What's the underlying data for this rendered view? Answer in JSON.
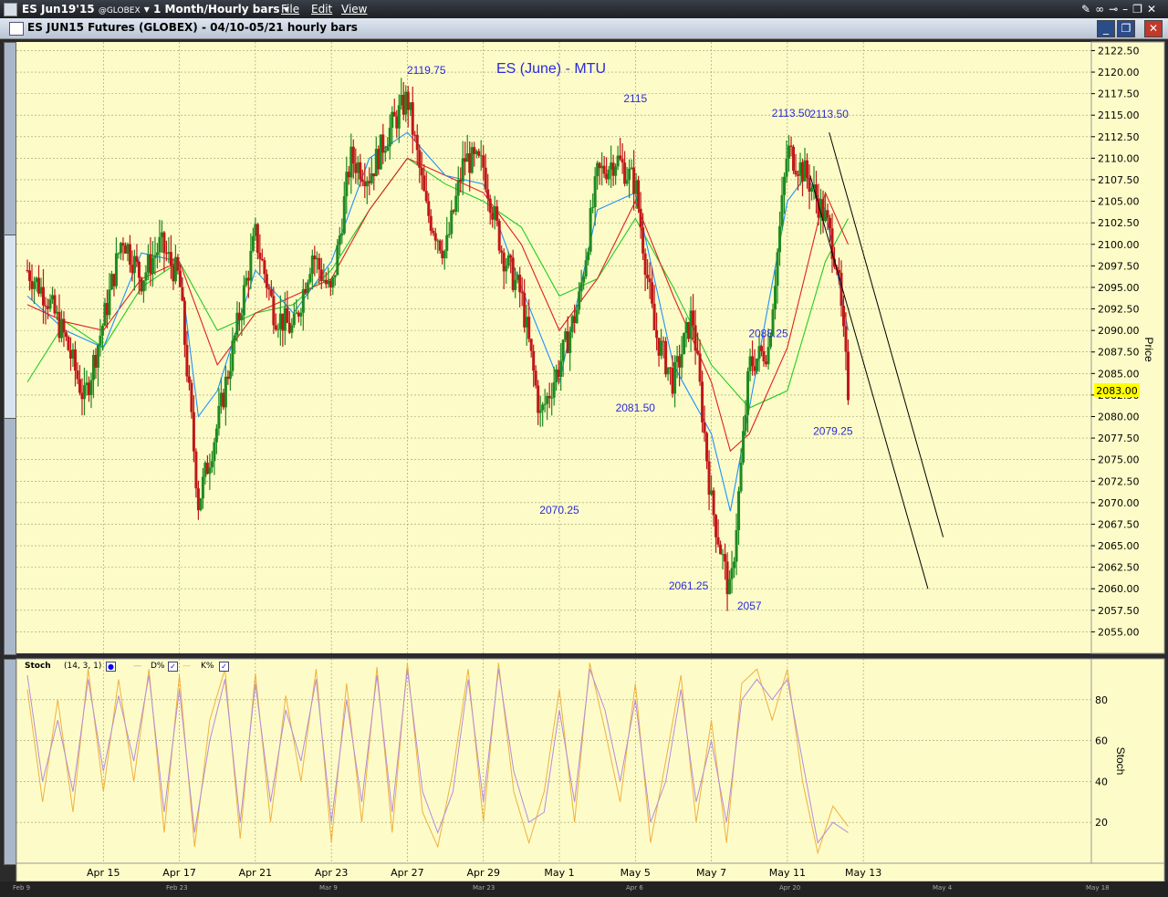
{
  "toolbar": {
    "symbol": "ES Jun19'15",
    "exchange": "@GLOBEX",
    "period": "1 Month/Hourly bars",
    "menu_file": "File",
    "menu_edit": "Edit",
    "menu_view": "View"
  },
  "window": {
    "title": "ES JUN15 Futures (GLOBEX) - 04/10-05/21 hourly bars"
  },
  "colors": {
    "background": "#fdfcc8",
    "up_bar": "#1f8a1f",
    "down_bar": "#c01818",
    "ma_fast": "#1e90ff",
    "ma_mid": "#e02020",
    "ma_slow": "#22cc22",
    "stoch_d": "#b58ce0",
    "stoch_k": "#f0b040",
    "annotation": "#2a2adc",
    "last_price_bg": "#ffff00"
  },
  "chart_data": [
    {
      "type": "line",
      "title": "ES (June) - MTU",
      "ylabel": "Price",
      "ylim": [
        2052.5,
        2123.5
      ],
      "yticks": [
        2122.5,
        2120.0,
        2117.5,
        2115.0,
        2112.5,
        2110.0,
        2107.5,
        2105.0,
        2102.5,
        2100.0,
        2097.5,
        2095.0,
        2092.5,
        2090.0,
        2087.5,
        2085.0,
        2082.5,
        2080.0,
        2077.5,
        2075.0,
        2072.5,
        2070.0,
        2067.5,
        2065.0,
        2062.5,
        2060.0,
        2057.5,
        2055.0
      ],
      "ytick_labels": [
        "2122.50",
        "2120.00",
        "2117.50",
        "2115.00",
        "2112.50",
        "2110.00",
        "2107.50",
        "2105.00",
        "2102.50",
        "2100.00",
        "2097.50",
        "2095.00",
        "2092.50",
        "2090.00",
        "2087.50",
        "2085.00",
        "2082.50",
        "2080.00",
        "2077.50",
        "2075.00",
        "2072.50",
        "2070.00",
        "2067.50",
        "2065.00",
        "2062.50",
        "2060.00",
        "2057.50",
        "2055.00"
      ],
      "last_price": "2083.00",
      "xticks": [
        "Apr 15",
        "Apr 17",
        "Apr 21",
        "Apr 23",
        "Apr 27",
        "Apr 29",
        "May 1",
        "May 5",
        "May 7",
        "May 11",
        "May 13"
      ],
      "x_range": [
        0,
        28
      ],
      "xtick_index": [
        2,
        4,
        6,
        8,
        10,
        12,
        14,
        16,
        18,
        20,
        22
      ],
      "grid": true,
      "price_path": [
        [
          0,
          2097
        ],
        [
          0.5,
          2094
        ],
        [
          1,
          2089
        ],
        [
          1.5,
          2082
        ],
        [
          2,
          2091
        ],
        [
          2.5,
          2101
        ],
        [
          3,
          2096
        ],
        [
          3.5,
          2100
        ],
        [
          4,
          2096
        ],
        [
          4.5,
          2070
        ],
        [
          5,
          2079
        ],
        [
          5.5,
          2090
        ],
        [
          6,
          2101
        ],
        [
          6.5,
          2092
        ],
        [
          7,
          2090
        ],
        [
          7.5,
          2099
        ],
        [
          8,
          2094
        ],
        [
          8.5,
          2110
        ],
        [
          9,
          2108
        ],
        [
          9.5,
          2113
        ],
        [
          10,
          2117
        ],
        [
          10.5,
          2104
        ],
        [
          11,
          2099
        ],
        [
          11.5,
          2110
        ],
        [
          12,
          2109
        ],
        [
          12.5,
          2099
        ],
        [
          13,
          2094
        ],
        [
          13.5,
          2080
        ],
        [
          14,
          2086
        ],
        [
          14.5,
          2093
        ],
        [
          15,
          2108
        ],
        [
          15.5,
          2110
        ],
        [
          16,
          2107
        ],
        [
          16.5,
          2090
        ],
        [
          17,
          2084
        ],
        [
          17.5,
          2092
        ],
        [
          18,
          2070
        ],
        [
          18.5,
          2059
        ],
        [
          19,
          2086
        ],
        [
          19.5,
          2088
        ],
        [
          20,
          2111
        ],
        [
          20.5,
          2108
        ],
        [
          21,
          2103
        ],
        [
          21.3,
          2098
        ],
        [
          21.6,
          2083
        ]
      ],
      "ma_fast": [
        [
          0,
          2094
        ],
        [
          1,
          2090
        ],
        [
          2,
          2088
        ],
        [
          3,
          2099
        ],
        [
          4,
          2098
        ],
        [
          4.5,
          2080
        ],
        [
          5,
          2083
        ],
        [
          6,
          2097
        ],
        [
          7,
          2092
        ],
        [
          8,
          2098
        ],
        [
          9,
          2110
        ],
        [
          10,
          2113
        ],
        [
          11,
          2108
        ],
        [
          12,
          2107
        ],
        [
          13,
          2095
        ],
        [
          14,
          2084
        ],
        [
          15,
          2104
        ],
        [
          16,
          2106
        ],
        [
          16.5,
          2096
        ],
        [
          17,
          2086
        ],
        [
          18,
          2078
        ],
        [
          18.5,
          2069
        ],
        [
          19,
          2081
        ],
        [
          20,
          2105
        ],
        [
          20.5,
          2108
        ],
        [
          21,
          2104
        ],
        [
          21.6,
          2090
        ]
      ],
      "ma_mid": [
        [
          0,
          2093
        ],
        [
          1,
          2091
        ],
        [
          2,
          2090
        ],
        [
          3,
          2096
        ],
        [
          4,
          2098
        ],
        [
          5,
          2086
        ],
        [
          6,
          2092
        ],
        [
          7,
          2094
        ],
        [
          8,
          2096
        ],
        [
          9,
          2104
        ],
        [
          10,
          2110
        ],
        [
          11,
          2108
        ],
        [
          12,
          2106
        ],
        [
          13,
          2100
        ],
        [
          14,
          2090
        ],
        [
          15,
          2096
        ],
        [
          16,
          2105
        ],
        [
          17,
          2094
        ],
        [
          18,
          2084
        ],
        [
          18.5,
          2076
        ],
        [
          19,
          2078
        ],
        [
          20,
          2088
        ],
        [
          21,
          2106
        ],
        [
          21.6,
          2100
        ]
      ],
      "ma_slow": [
        [
          0,
          2084
        ],
        [
          1,
          2091
        ],
        [
          2,
          2088
        ],
        [
          3,
          2095
        ],
        [
          4,
          2098
        ],
        [
          5,
          2090
        ],
        [
          6,
          2092
        ],
        [
          7,
          2093
        ],
        [
          8,
          2097
        ],
        [
          9,
          2104
        ],
        [
          10,
          2110
        ],
        [
          11,
          2107
        ],
        [
          12,
          2105
        ],
        [
          13,
          2102
        ],
        [
          14,
          2094
        ],
        [
          15,
          2096
        ],
        [
          16,
          2103
        ],
        [
          17,
          2095
        ],
        [
          18,
          2086
        ],
        [
          19,
          2081
        ],
        [
          20,
          2083
        ],
        [
          21,
          2098
        ],
        [
          21.6,
          2103
        ]
      ],
      "annotations": [
        {
          "text": "2119.75",
          "x": 10.5,
          "y": 2119.8
        },
        {
          "text": "2115",
          "x": 16,
          "y": 2116.5
        },
        {
          "text": "2113.50",
          "x": 20.1,
          "y": 2114.8
        },
        {
          "text": "2113.50",
          "x": 21.1,
          "y": 2114.7
        },
        {
          "text": "2088.25",
          "x": 19.5,
          "y": 2089.2
        },
        {
          "text": "2081.50",
          "x": 16,
          "y": 2080.6
        },
        {
          "text": "2079.25",
          "x": 21.2,
          "y": 2077.9
        },
        {
          "text": "2070.25",
          "x": 14,
          "y": 2068.7
        },
        {
          "text": "2061.25",
          "x": 17.4,
          "y": 2059.9
        },
        {
          "text": "2057",
          "x": 19,
          "y": 2057.6
        }
      ],
      "trend_lines": [
        [
          [
            21.1,
            2113.0
          ],
          [
            24.1,
            2066.0
          ]
        ],
        [
          [
            20.6,
            2108.0
          ],
          [
            23.7,
            2060.0
          ]
        ]
      ]
    },
    {
      "type": "line",
      "title": "Stoch",
      "params": "(14, 3, 1)",
      "legend": [
        "D%",
        "K%"
      ],
      "ylabel": "Stoch",
      "ylim": [
        0,
        100
      ],
      "yticks": [
        20,
        40,
        60,
        80
      ],
      "ytick_labels": [
        "20",
        "40",
        "60",
        "80"
      ],
      "d_series": [
        [
          0,
          92
        ],
        [
          0.4,
          40
        ],
        [
          0.8,
          70
        ],
        [
          1.2,
          35
        ],
        [
          1.6,
          90
        ],
        [
          2.0,
          45
        ],
        [
          2.4,
          82
        ],
        [
          2.8,
          50
        ],
        [
          3.2,
          92
        ],
        [
          3.6,
          25
        ],
        [
          4.0,
          85
        ],
        [
          4.4,
          15
        ],
        [
          4.8,
          60
        ],
        [
          5.2,
          90
        ],
        [
          5.6,
          20
        ],
        [
          6.0,
          88
        ],
        [
          6.4,
          30
        ],
        [
          6.8,
          75
        ],
        [
          7.2,
          50
        ],
        [
          7.6,
          90
        ],
        [
          8.0,
          20
        ],
        [
          8.4,
          80
        ],
        [
          8.8,
          30
        ],
        [
          9.2,
          92
        ],
        [
          9.6,
          25
        ],
        [
          10.0,
          95
        ],
        [
          10.4,
          35
        ],
        [
          10.8,
          15
        ],
        [
          11.2,
          35
        ],
        [
          11.6,
          90
        ],
        [
          12.0,
          30
        ],
        [
          12.4,
          95
        ],
        [
          12.8,
          45
        ],
        [
          13.2,
          20
        ],
        [
          13.6,
          25
        ],
        [
          14.0,
          75
        ],
        [
          14.4,
          30
        ],
        [
          14.8,
          95
        ],
        [
          15.2,
          75
        ],
        [
          15.6,
          40
        ],
        [
          16.0,
          80
        ],
        [
          16.4,
          20
        ],
        [
          16.8,
          40
        ],
        [
          17.2,
          85
        ],
        [
          17.6,
          30
        ],
        [
          18.0,
          60
        ],
        [
          18.4,
          20
        ],
        [
          18.8,
          80
        ],
        [
          19.2,
          90
        ],
        [
          19.6,
          80
        ],
        [
          20.0,
          90
        ],
        [
          20.4,
          50
        ],
        [
          20.8,
          10
        ],
        [
          21.2,
          20
        ],
        [
          21.6,
          15
        ]
      ],
      "k_series": [
        [
          0,
          85
        ],
        [
          0.4,
          30
        ],
        [
          0.8,
          80
        ],
        [
          1.2,
          25
        ],
        [
          1.6,
          95
        ],
        [
          2.0,
          35
        ],
        [
          2.4,
          90
        ],
        [
          2.8,
          40
        ],
        [
          3.2,
          95
        ],
        [
          3.6,
          15
        ],
        [
          4.0,
          92
        ],
        [
          4.4,
          8
        ],
        [
          4.8,
          70
        ],
        [
          5.2,
          95
        ],
        [
          5.6,
          12
        ],
        [
          6.0,
          93
        ],
        [
          6.4,
          20
        ],
        [
          6.8,
          82
        ],
        [
          7.2,
          40
        ],
        [
          7.6,
          95
        ],
        [
          8.0,
          10
        ],
        [
          8.4,
          88
        ],
        [
          8.8,
          20
        ],
        [
          9.2,
          96
        ],
        [
          9.6,
          15
        ],
        [
          10.0,
          98
        ],
        [
          10.4,
          25
        ],
        [
          10.8,
          8
        ],
        [
          11.2,
          45
        ],
        [
          11.6,
          95
        ],
        [
          12.0,
          20
        ],
        [
          12.4,
          98
        ],
        [
          12.8,
          35
        ],
        [
          13.2,
          10
        ],
        [
          13.6,
          35
        ],
        [
          14.0,
          85
        ],
        [
          14.4,
          20
        ],
        [
          14.8,
          98
        ],
        [
          15.2,
          65
        ],
        [
          15.6,
          30
        ],
        [
          16.0,
          88
        ],
        [
          16.4,
          10
        ],
        [
          16.8,
          50
        ],
        [
          17.2,
          92
        ],
        [
          17.6,
          20
        ],
        [
          18.0,
          70
        ],
        [
          18.4,
          10
        ],
        [
          18.8,
          88
        ],
        [
          19.2,
          95
        ],
        [
          19.6,
          70
        ],
        [
          20.0,
          95
        ],
        [
          20.4,
          40
        ],
        [
          20.8,
          5
        ],
        [
          21.2,
          28
        ],
        [
          21.6,
          18
        ]
      ]
    }
  ],
  "stoch_header": {
    "name": "Stoch",
    "params": "(14, 3, 1)",
    "d_label": "D%",
    "k_label": "K%"
  },
  "timeline": [
    "Feb 9",
    "Feb 23",
    "Mar 9",
    "Mar 23",
    "Apr 6",
    "Apr 20",
    "May 4",
    "May 18"
  ]
}
